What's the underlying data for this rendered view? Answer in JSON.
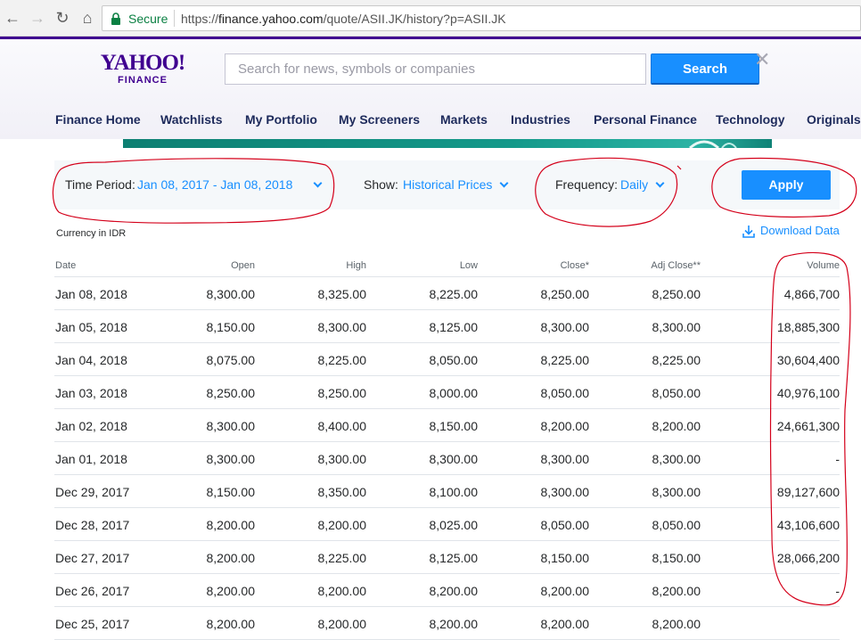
{
  "browser": {
    "secure_label": "Secure",
    "url_scheme": "https://",
    "url_host": "finance.yahoo.com",
    "url_path": "/quote/ASII.JK/history?p=ASII.JK"
  },
  "header": {
    "logo_main": "YAHOO!",
    "logo_sub": "FINANCE",
    "search_placeholder": "Search for news, symbols or companies",
    "search_button": "Search",
    "close_glyph": "✕"
  },
  "nav": {
    "items": [
      "Finance Home",
      "Watchlists",
      "My Portfolio",
      "My Screeners",
      "Markets",
      "Industries",
      "Personal Finance",
      "Technology",
      "Originals"
    ]
  },
  "controls": {
    "time_period_label": "Time Period:",
    "time_period_value": "Jan 08, 2017 - Jan 08, 2018",
    "show_label": "Show:",
    "show_value": "Historical Prices",
    "frequency_label": "Frequency:",
    "frequency_value": "Daily",
    "apply_button": "Apply"
  },
  "currency_note": "Currency in IDR",
  "download_label": "Download Data",
  "table": {
    "headers": [
      "Date",
      "Open",
      "High",
      "Low",
      "Close*",
      "Adj Close**",
      "Volume"
    ],
    "rows": [
      [
        "Jan 08, 2018",
        "8,300.00",
        "8,325.00",
        "8,225.00",
        "8,250.00",
        "8,250.00",
        "4,866,700"
      ],
      [
        "Jan 05, 2018",
        "8,150.00",
        "8,300.00",
        "8,125.00",
        "8,300.00",
        "8,300.00",
        "18,885,300"
      ],
      [
        "Jan 04, 2018",
        "8,075.00",
        "8,225.00",
        "8,050.00",
        "8,225.00",
        "8,225.00",
        "30,604,400"
      ],
      [
        "Jan 03, 2018",
        "8,250.00",
        "8,250.00",
        "8,000.00",
        "8,050.00",
        "8,050.00",
        "40,976,100"
      ],
      [
        "Jan 02, 2018",
        "8,300.00",
        "8,400.00",
        "8,150.00",
        "8,200.00",
        "8,200.00",
        "24,661,300"
      ],
      [
        "Jan 01, 2018",
        "8,300.00",
        "8,300.00",
        "8,300.00",
        "8,300.00",
        "8,300.00",
        "-"
      ],
      [
        "Dec 29, 2017",
        "8,150.00",
        "8,350.00",
        "8,100.00",
        "8,300.00",
        "8,300.00",
        "89,127,600"
      ],
      [
        "Dec 28, 2017",
        "8,200.00",
        "8,200.00",
        "8,025.00",
        "8,050.00",
        "8,050.00",
        "43,106,600"
      ],
      [
        "Dec 27, 2017",
        "8,200.00",
        "8,225.00",
        "8,125.00",
        "8,150.00",
        "8,150.00",
        "28,066,200"
      ],
      [
        "Dec 26, 2017",
        "8,200.00",
        "8,200.00",
        "8,200.00",
        "8,200.00",
        "8,200.00",
        "-"
      ],
      [
        "Dec 25, 2017",
        "8,200.00",
        "8,200.00",
        "8,200.00",
        "8,200.00",
        "8,200.00",
        ""
      ]
    ]
  },
  "colors": {
    "yahoo_purple": "#400090",
    "link_blue": "#188fff",
    "annotation_red": "#d4001a"
  }
}
